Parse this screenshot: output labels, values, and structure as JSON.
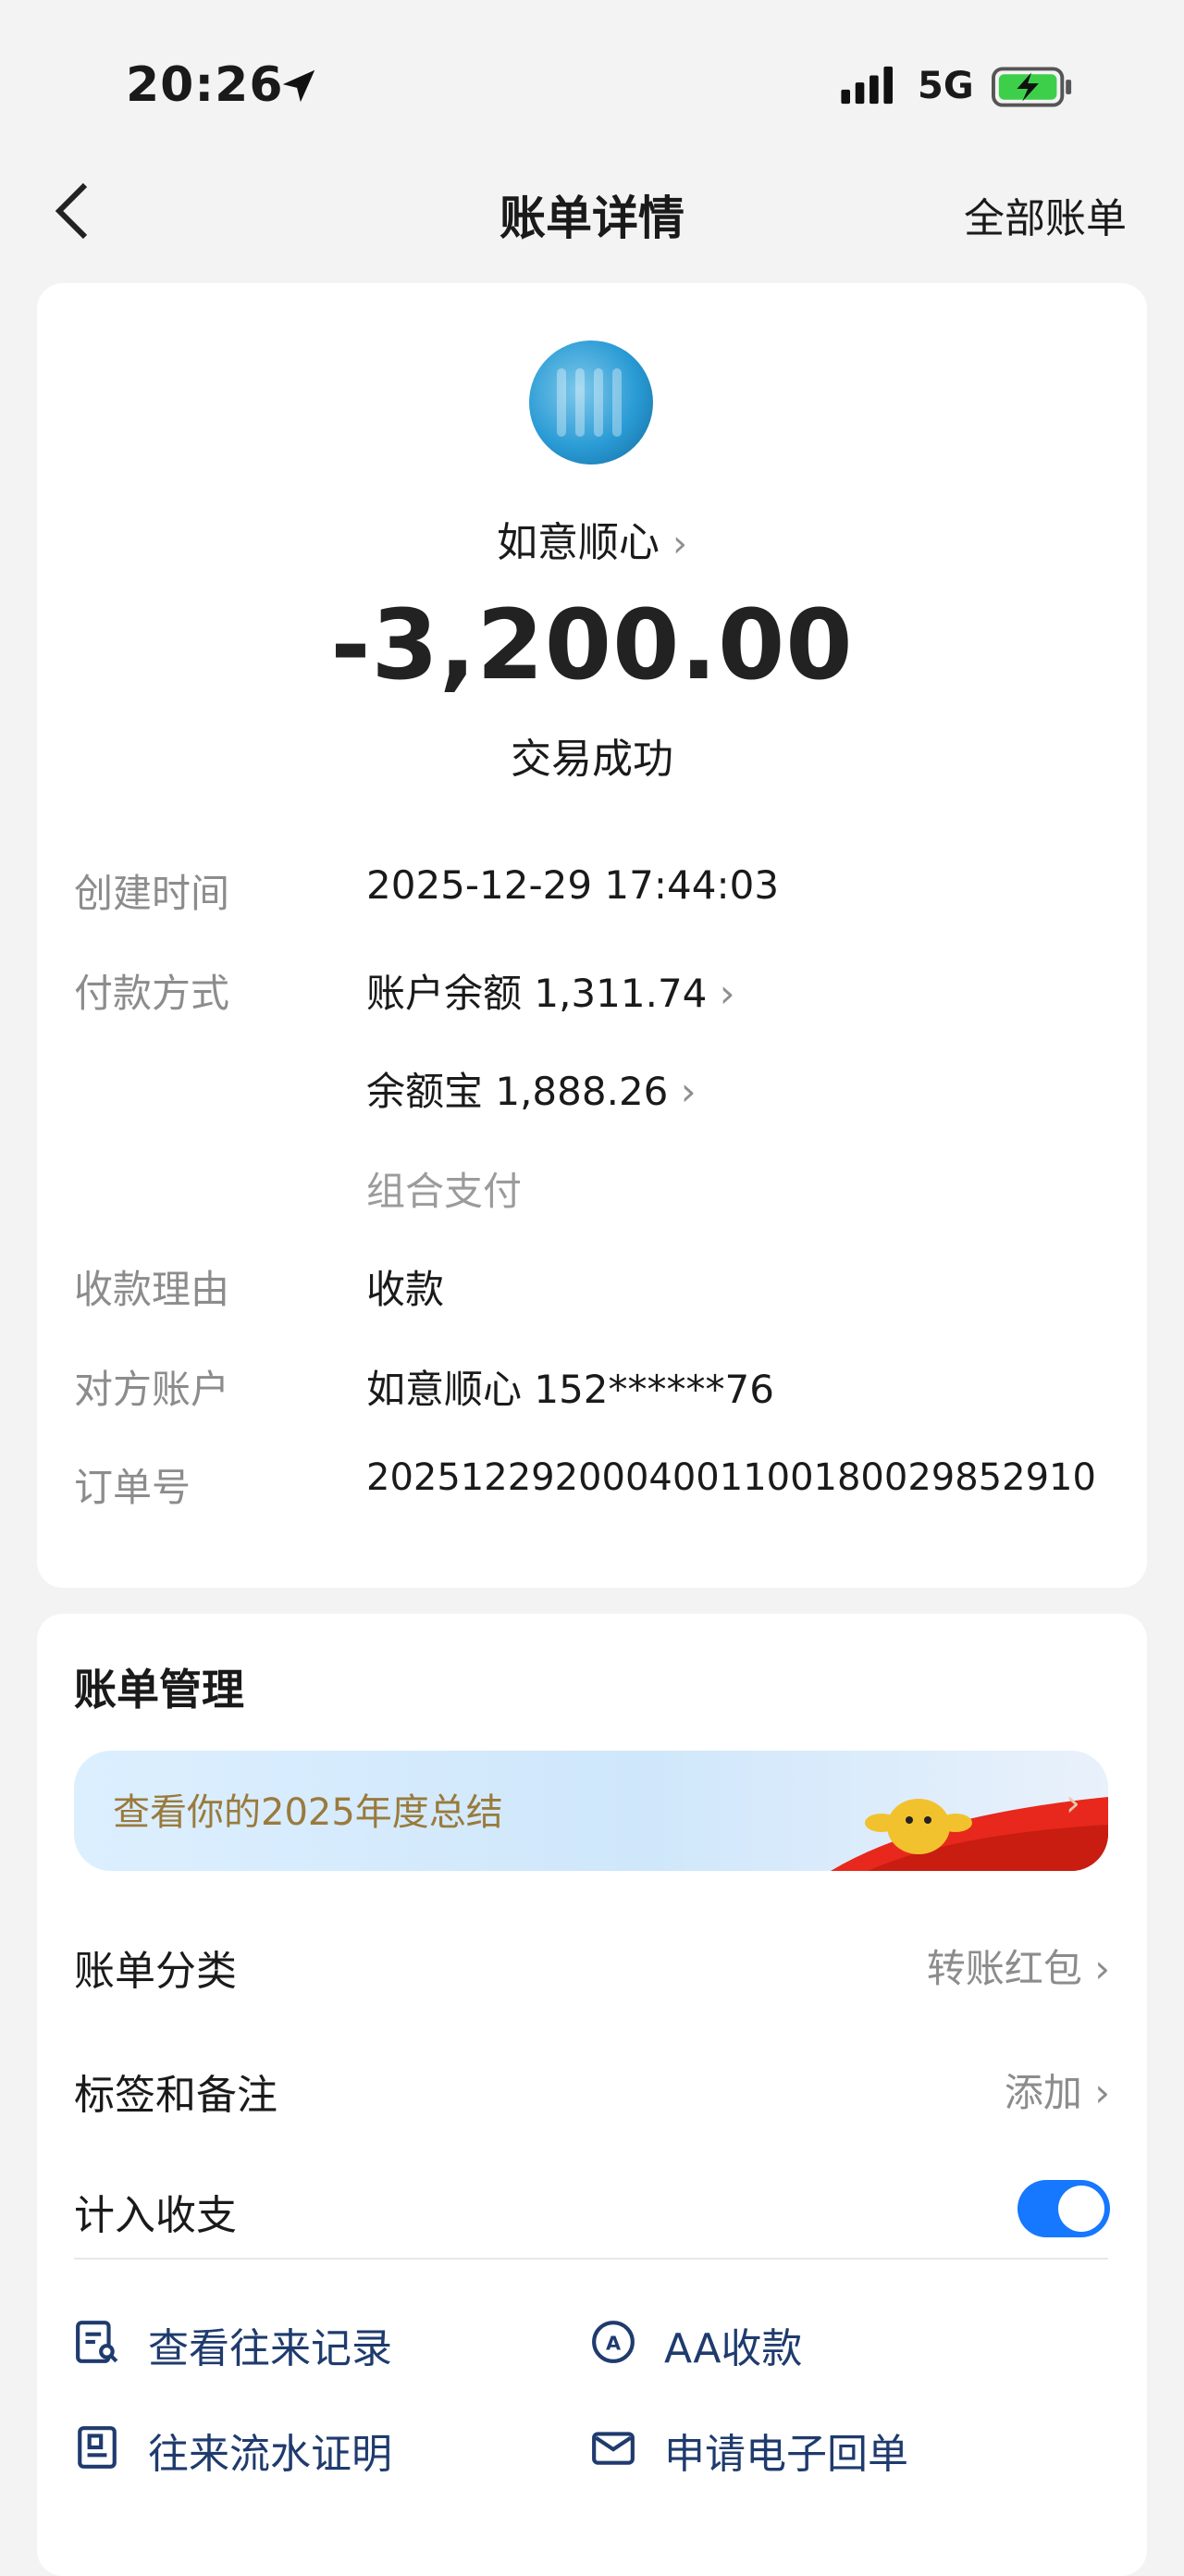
{
  "status_bar": {
    "time": "20:26",
    "network": "5G"
  },
  "nav": {
    "title": "账单详情",
    "all_bills": "全部账单"
  },
  "transaction": {
    "payee": "如意顺心",
    "amount": "-3,200.00",
    "state": "交易成功"
  },
  "details": {
    "created_label": "创建时间",
    "created_value": "2025-12-29 17:44:03",
    "payment_label": "付款方式",
    "payment_1": "账户余额 1,311.74",
    "payment_2": "余额宝 1,888.26",
    "payment_note": "组合支付",
    "reason_label": "收款理由",
    "reason_value": "收款",
    "counterparty_label": "对方账户",
    "counterparty_value": "如意顺心 152******76",
    "order_label": "订单号",
    "order_value": "2025122920004001100180029852910"
  },
  "management": {
    "title": "账单管理",
    "banner_text": "查看你的2025年度总结",
    "category_label": "账单分类",
    "category_value": "转账红包",
    "tags_label": "标签和备注",
    "tags_value": "添加",
    "include_label": "计入收支",
    "include_on": true,
    "links": {
      "history": "查看往来记录",
      "aa": "AA收款",
      "proof": "往来流水证明",
      "receipt": "申请电子回单"
    }
  },
  "colors": {
    "accent": "#1677ff",
    "link": "#1f3b6e",
    "background": "#f3f3f3"
  }
}
